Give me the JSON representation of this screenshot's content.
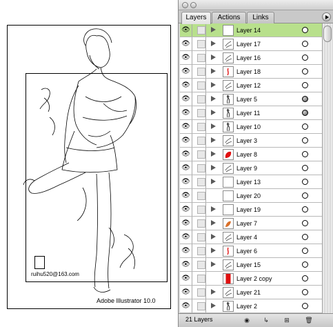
{
  "artboard": {
    "email": "ruihu520@163.com",
    "caption": "Adobe Illustrator 10.0"
  },
  "palette": {
    "tabs": [
      {
        "label": "Layers",
        "active": true
      },
      {
        "label": "Actions",
        "active": false
      },
      {
        "label": "Links",
        "active": false
      }
    ],
    "menu_icon": "palette-menu-icon",
    "layers": [
      {
        "name": "Layer 14",
        "selected": true,
        "expandable": true,
        "target": "empty",
        "thumb": "blank"
      },
      {
        "name": "Layer 17",
        "selected": false,
        "expandable": true,
        "target": "empty",
        "thumb": "sketch"
      },
      {
        "name": "Layer 16",
        "selected": false,
        "expandable": true,
        "target": "empty",
        "thumb": "sketch"
      },
      {
        "name": "Layer 18",
        "selected": false,
        "expandable": true,
        "target": "empty",
        "thumb": "red-stroke"
      },
      {
        "name": "Layer 12",
        "selected": false,
        "expandable": true,
        "target": "empty",
        "thumb": "sketch"
      },
      {
        "name": "Layer 5",
        "selected": false,
        "expandable": true,
        "target": "filled",
        "thumb": "figure"
      },
      {
        "name": "Layer 11",
        "selected": false,
        "expandable": true,
        "target": "filled",
        "thumb": "figure"
      },
      {
        "name": "Layer 10",
        "selected": false,
        "expandable": true,
        "target": "empty",
        "thumb": "figure"
      },
      {
        "name": "Layer 3",
        "selected": false,
        "expandable": true,
        "target": "empty",
        "thumb": "sketch"
      },
      {
        "name": "Layer 8",
        "selected": false,
        "expandable": true,
        "target": "empty",
        "thumb": "red-fill"
      },
      {
        "name": "Layer 9",
        "selected": false,
        "expandable": true,
        "target": "empty",
        "thumb": "sketch"
      },
      {
        "name": "Layer 13",
        "selected": false,
        "expandable": true,
        "target": "empty",
        "thumb": "blank"
      },
      {
        "name": "Layer 20",
        "selected": false,
        "expandable": false,
        "target": "empty",
        "thumb": "blank"
      },
      {
        "name": "Layer 19",
        "selected": false,
        "expandable": true,
        "target": "empty",
        "thumb": "blank"
      },
      {
        "name": "Layer 7",
        "selected": false,
        "expandable": true,
        "target": "empty",
        "thumb": "orange"
      },
      {
        "name": "Layer 4",
        "selected": false,
        "expandable": true,
        "target": "empty",
        "thumb": "sketch"
      },
      {
        "name": "Layer 6",
        "selected": false,
        "expandable": true,
        "target": "empty",
        "thumb": "red-stroke"
      },
      {
        "name": "Layer 15",
        "selected": false,
        "expandable": true,
        "target": "empty",
        "thumb": "sketch"
      },
      {
        "name": "Layer 2 copy",
        "selected": false,
        "expandable": false,
        "target": "empty",
        "thumb": "red-block"
      },
      {
        "name": "Layer 21",
        "selected": false,
        "expandable": true,
        "target": "empty",
        "thumb": "sketch"
      },
      {
        "name": "Layer 2",
        "selected": false,
        "expandable": true,
        "target": "empty",
        "thumb": "figure"
      }
    ],
    "footer": {
      "count": "21 Layers",
      "icons": [
        "make-clipping-mask-icon",
        "create-sublayer-icon",
        "create-new-layer-icon",
        "delete-layer-icon"
      ]
    },
    "colors": {
      "selected_row": "#b8e08c",
      "red_thumb": "#e01010",
      "orange_thumb": "#d9702a"
    }
  }
}
